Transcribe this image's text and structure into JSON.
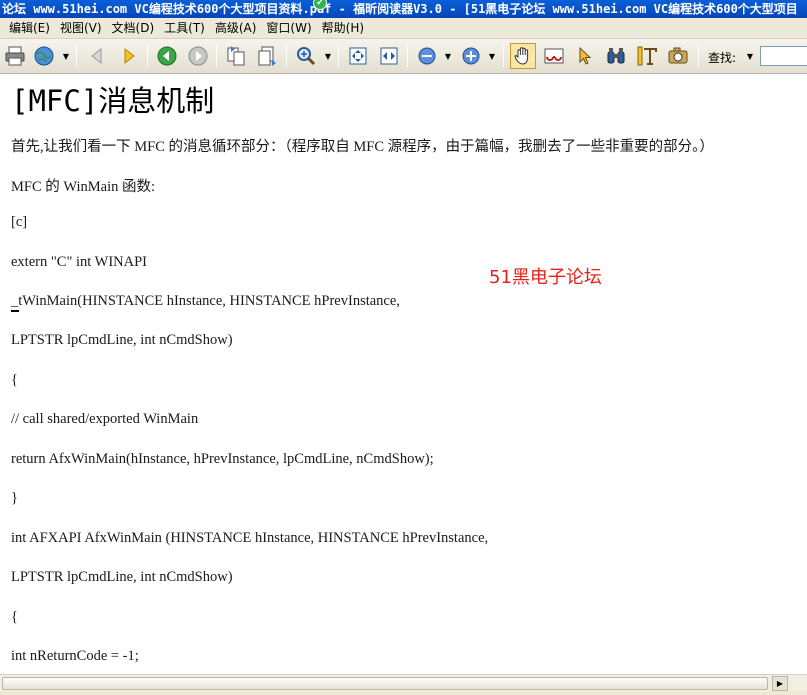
{
  "window": {
    "title": "论坛 www.51hei.com VC编程技术600个大型项目资料.pdf - 福昕阅读器V3.0 - [51黑电子论坛 www.51hei.com VC编程技术600个大型项目"
  },
  "menu": [
    {
      "label": "编辑(E)"
    },
    {
      "label": "视图(V)"
    },
    {
      "label": "文档(D)"
    },
    {
      "label": "工具(T)"
    },
    {
      "label": "高级(A)"
    },
    {
      "label": "窗口(W)"
    },
    {
      "label": "帮助(H)"
    }
  ],
  "toolbar": {
    "find_label": "查找:",
    "find_value": "",
    "accent_color": "#fbe7a5"
  },
  "document": {
    "title": "[MFC]消息机制",
    "watermark": "51黑电子论坛",
    "lines": [
      "首先,让我们看一下 MFC 的消息循环部分：（程序取自 MFC 源程序，由于篇幅，我删去了一些非重要的部分。）",
      "MFC 的 WinMain 函数:",
      "[c]",
      "extern \"C\" int WINAPI",
      "_tWinMain(HINSTANCE hInstance, HINSTANCE hPrevInstance,",
      "LPTSTR lpCmdLine, int nCmdShow)",
      "{",
      "// call shared/exported WinMain",
      "return AfxWinMain(hInstance, hPrevInstance, lpCmdLine, nCmdShow);",
      "}",
      "int AFXAPI AfxWinMain (HINSTANCE hInstance, HINSTANCE hPrevInstance,",
      "LPTSTR lpCmdLine, int nCmdShow)",
      "{",
      "int nReturnCode = -1;"
    ]
  }
}
